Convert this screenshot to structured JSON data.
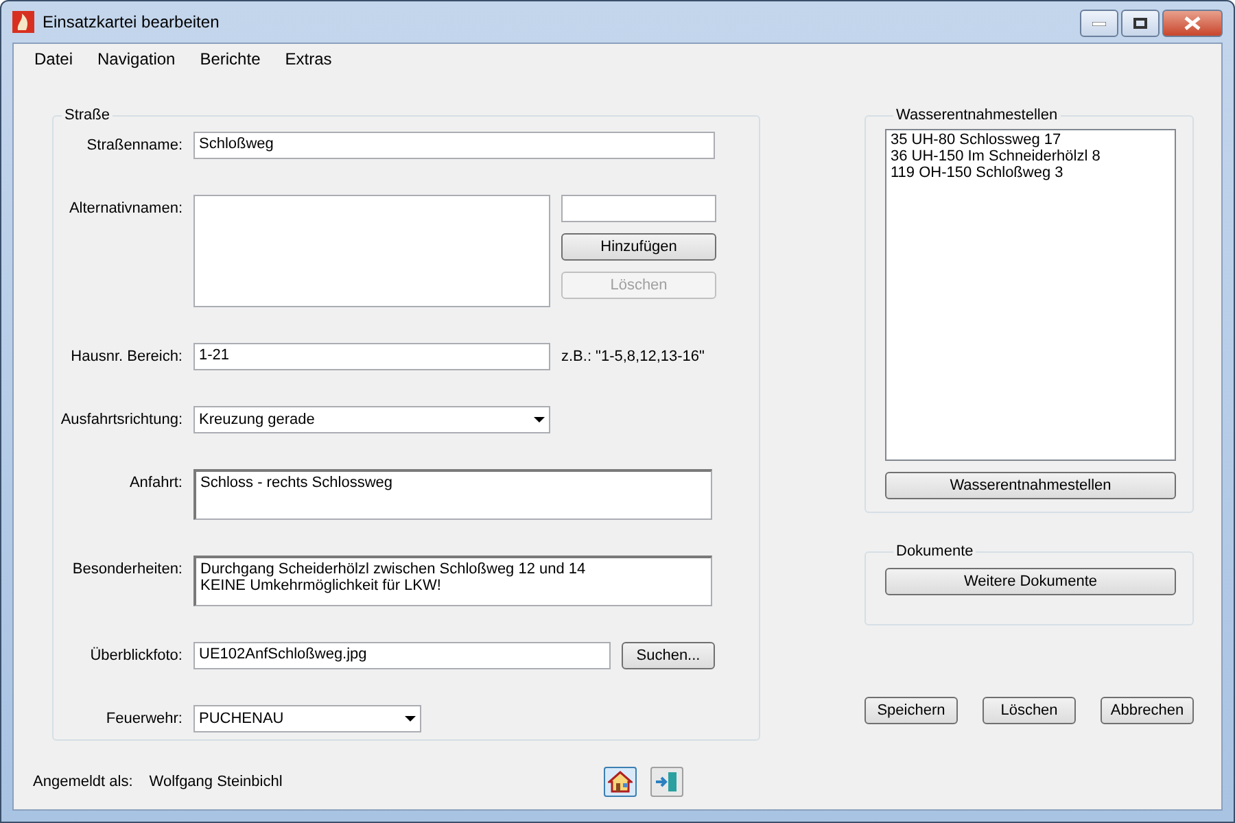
{
  "window": {
    "title": "Einsatzkartei bearbeiten"
  },
  "menu": [
    "Datei",
    "Navigation",
    "Berichte",
    "Extras"
  ],
  "street_group": {
    "title": "Straße",
    "street_name": {
      "label": "Straßenname:",
      "value": "Schloßweg"
    },
    "alt_names": {
      "label": "Alternativnamen:",
      "add_button": {
        "label": "Hinzufügen",
        "disabled": false
      },
      "delete_button": {
        "label": "Löschen",
        "disabled": true
      }
    },
    "house_numbers": {
      "label": "Hausnr. Bereich:",
      "value": "1-21",
      "hint": "z.B.: \"1-5,8,12,13-16\""
    },
    "exit_direction": {
      "label": "Ausfahrtsrichtung:",
      "value": "Kreuzung gerade"
    },
    "approach": {
      "label": "Anfahrt:",
      "value": "Schloss - rechts Schlossweg"
    },
    "notes": {
      "label": "Besonderheiten:",
      "lines": [
        "Durchgang Scheiderhölzl zwischen Schloßweg 12 und 14",
        "KEINE Umkehrmöglichkeit für LKW!"
      ]
    },
    "photo": {
      "label": "Überblickfoto:",
      "value": "UE102AnfSchloßweg.jpg",
      "button": "Suchen..."
    },
    "fire_brigade": {
      "label": "Feuerwehr:",
      "value": "PUCHENAU"
    }
  },
  "water_group": {
    "title": "Wasserentnahmestellen",
    "items": [
      "35 UH-80 Schlossweg 17",
      "36 UH-150 Im Schneiderhölzl 8",
      "119 OH-150 Schloßweg 3"
    ],
    "button": "Wasserentnahmestellen"
  },
  "documents_group": {
    "title": "Dokumente",
    "button": "Weitere Dokumente"
  },
  "actions": [
    "Speichern",
    "Löschen",
    "Abbrechen"
  ],
  "status": {
    "label": "Angemeldt als:",
    "user": "Wolfgang Steinbichl",
    "buttons": [
      {
        "kind": "home",
        "selected": true
      },
      {
        "kind": "exit",
        "selected": false
      }
    ]
  }
}
